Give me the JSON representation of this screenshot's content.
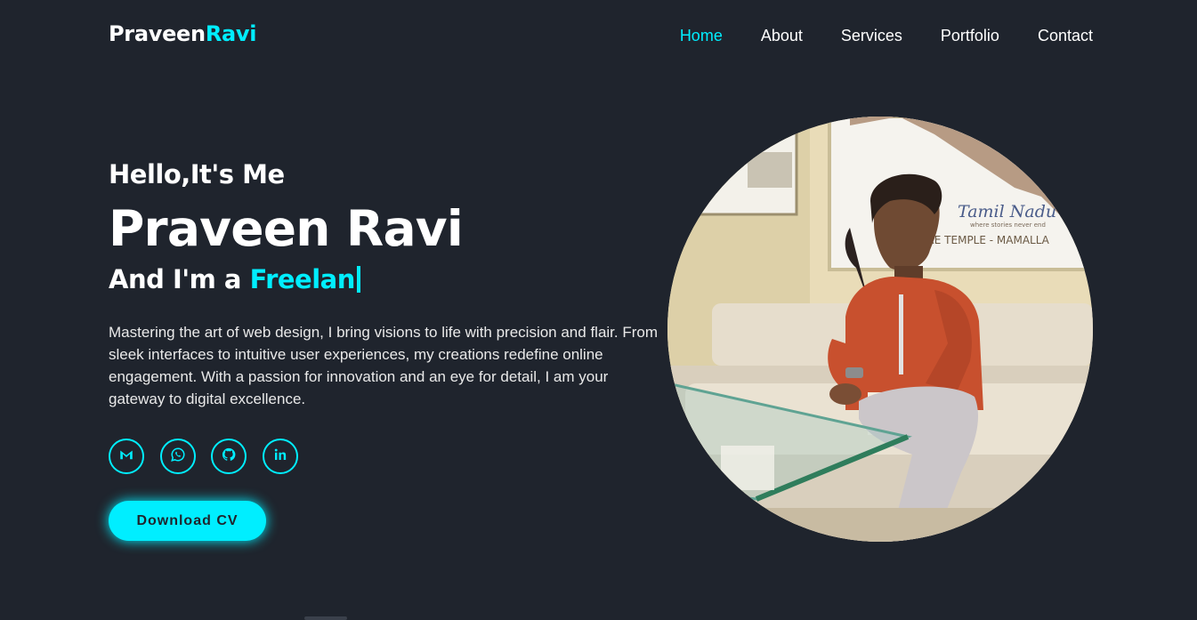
{
  "brand": {
    "first": "Praveen",
    "accent": "Ravi"
  },
  "nav": [
    {
      "label": "Home",
      "active": true
    },
    {
      "label": "About",
      "active": false
    },
    {
      "label": "Services",
      "active": false
    },
    {
      "label": "Portfolio",
      "active": false
    },
    {
      "label": "Contact",
      "active": false
    }
  ],
  "hero": {
    "greeting": "Hello,It's Me",
    "name": "Praveen Ravi",
    "role_prefix": "And I'm a",
    "role_typed": "Freelan",
    "description": "Mastering the art of web design, I bring visions to life with precision and flair. From sleek interfaces to intuitive user experiences, my creations redefine online engagement. With a passion for innovation and an eye for detail, I am your gateway to digital excellence.",
    "cta": "Download CV"
  },
  "socials": [
    {
      "icon": "gmail-icon"
    },
    {
      "icon": "whatsapp-icon"
    },
    {
      "icon": "github-icon"
    },
    {
      "icon": "linkedin-icon"
    }
  ],
  "portrait": {
    "poster_script": "Tamil Nadu",
    "poster_tagline": "where stories never end",
    "poster_caption": "ORE TEMPLE - MAMALLA"
  },
  "colors": {
    "background": "#1f242d",
    "accent": "#00eeff",
    "text": "#ffffff"
  }
}
